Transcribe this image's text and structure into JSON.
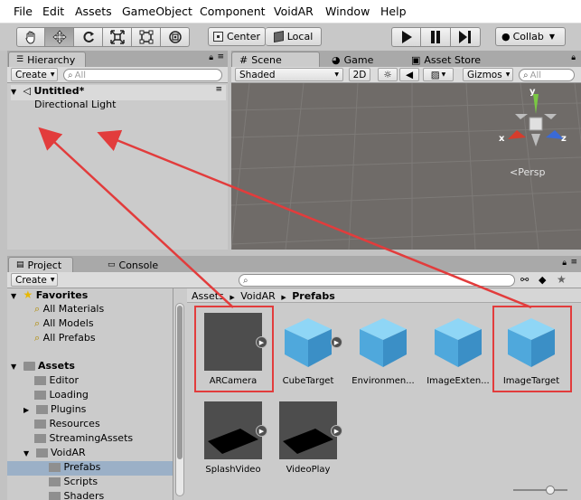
{
  "menu": [
    "File",
    "Edit",
    "Assets",
    "GameObject",
    "Component",
    "VoidAR",
    "Window",
    "Help"
  ],
  "toolbar": {
    "tools": [
      "hand-icon",
      "move-icon",
      "rotate-icon",
      "scale-icon",
      "rect-tool-icon",
      "transform-icon"
    ],
    "pivot_label": "Center",
    "space_label": "Local",
    "collab_label": "Collab"
  },
  "hierarchy": {
    "tab": "Hierarchy",
    "create": "Create",
    "search_placeholder": "All",
    "scene_name": "Untitled*",
    "items": [
      "Directional Light"
    ]
  },
  "scene_tabs": {
    "scene": "Scene",
    "game": "Game",
    "asset_store": "Asset Store"
  },
  "scene_bar": {
    "shading": "Shaded",
    "mode_2d": "2D",
    "gizmos": "Gizmos",
    "search_placeholder": "All"
  },
  "gizmo": {
    "x": "x",
    "y": "y",
    "z": "z",
    "persp": "Persp"
  },
  "project": {
    "tab": "Project",
    "console_tab": "Console",
    "create": "Create",
    "breadcrumb": [
      "Assets",
      "VoidAR",
      "Prefabs"
    ],
    "favorites_label": "Favorites",
    "favorites": [
      "All Materials",
      "All Models",
      "All Prefabs"
    ],
    "assets_label": "Assets",
    "folders": [
      "Editor",
      "Loading",
      "Plugins",
      "Resources",
      "StreamingAssets",
      "VoidAR",
      "Prefabs",
      "Scripts",
      "Shaders"
    ],
    "assets": [
      {
        "name": "ARCamera",
        "kind": "dark"
      },
      {
        "name": "CubeTarget",
        "kind": "cube"
      },
      {
        "name": "Environmen...",
        "kind": "cube"
      },
      {
        "name": "ImageExten...",
        "kind": "cube"
      },
      {
        "name": "ImageTarget",
        "kind": "cube"
      },
      {
        "name": "SplashVideo",
        "kind": "plane"
      },
      {
        "name": "VideoPlay",
        "kind": "plane"
      }
    ]
  },
  "colors": {
    "annotation_red": "#e23c3c",
    "cube_blue": "#5cb8e8",
    "scene_bg": "#6f6b68"
  }
}
